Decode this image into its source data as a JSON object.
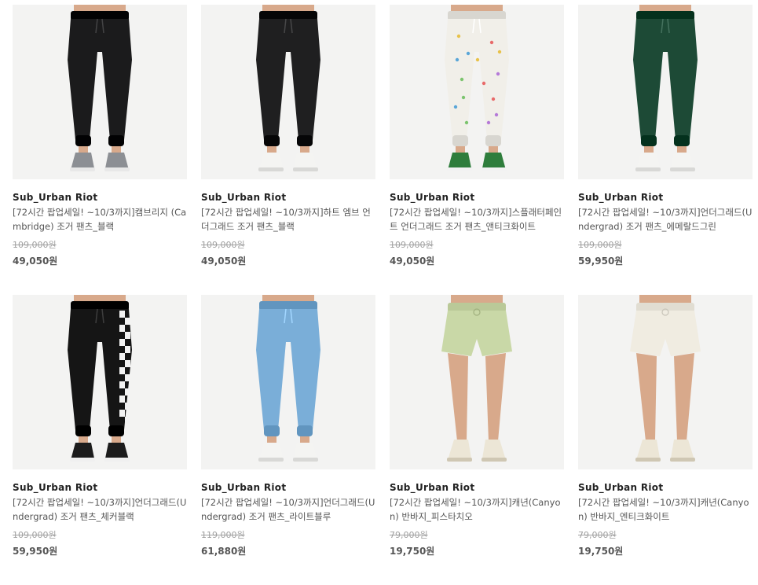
{
  "products": [
    {
      "brand": "Sub_Urban Riot",
      "name": "[72시간 팝업세일! ~10/3까지]캠브리지 (Cambridge) 조거 팬츠_블랙",
      "original_price": "109,000원",
      "sale_price": "49,050원",
      "item_color": "#1b1b1c",
      "type": "jogger",
      "pattern": "plain",
      "shoe": "sneaker-grey",
      "image_icon": "black-jogger-pants-photo"
    },
    {
      "brand": "Sub_Urban Riot",
      "name": "[72시간 팝업세일! ~10/3까지]하트 엠브 언더그래드 조거 팬츠_블랙",
      "original_price": "109,000원",
      "sale_price": "49,050원",
      "item_color": "#1f1f20",
      "type": "jogger",
      "pattern": "plain",
      "shoe": "white",
      "image_icon": "black-jogger-pants-photo"
    },
    {
      "brand": "Sub_Urban Riot",
      "name": "[72시간 팝업세일! ~10/3까지]스플래터페인트 언더그래드 조거 팬츠_앤티크화이트",
      "original_price": "109,000원",
      "sale_price": "49,050원",
      "item_color": "#f1efe9",
      "type": "jogger",
      "pattern": "splatter",
      "shoe": "green",
      "image_icon": "white-splatter-jogger-photo"
    },
    {
      "brand": "Sub_Urban Riot",
      "name": "[72시간 팝업세일! ~10/3까지]언더그래드(Undergrad) 조거 팬츠_에메랄드그린",
      "original_price": "109,000원",
      "sale_price": "59,950원",
      "item_color": "#1d4a36",
      "type": "jogger",
      "pattern": "plain",
      "shoe": "white",
      "image_icon": "green-jogger-pants-photo"
    },
    {
      "brand": "Sub_Urban Riot",
      "name": "[72시간 팝업세일! ~10/3까지]언더그래드(Undergrad) 조거 팬츠_체커블랙",
      "original_price": "109,000원",
      "sale_price": "59,950원",
      "item_color": "#151515",
      "type": "jogger",
      "pattern": "checker",
      "shoe": "black",
      "image_icon": "checker-jogger-pants-photo"
    },
    {
      "brand": "Sub_Urban Riot",
      "name": "[72시간 팝업세일! ~10/3까지]언더그래드(Undergrad) 조거 팬츠_라이트블루",
      "original_price": "119,000원",
      "sale_price": "61,880원",
      "item_color": "#7aaed8",
      "type": "jogger",
      "pattern": "plain",
      "shoe": "white",
      "image_icon": "blue-jogger-pants-photo"
    },
    {
      "brand": "Sub_Urban Riot",
      "name": "[72시간 팝업세일! ~10/3까지]캐년(Canyon) 반바지_피스타치오",
      "original_price": "79,000원",
      "sale_price": "19,750원",
      "item_color": "#c9d8a7",
      "type": "shorts",
      "pattern": "plain",
      "shoe": "cream",
      "image_icon": "pistachio-shorts-photo"
    },
    {
      "brand": "Sub_Urban Riot",
      "name": "[72시간 팝업세일! ~10/3까지]캐년(Canyon) 반바지_엔티크화이트",
      "original_price": "79,000원",
      "sale_price": "19,750원",
      "item_color": "#f0ece1",
      "type": "shorts",
      "pattern": "plain",
      "shoe": "cream",
      "image_icon": "white-shorts-photo"
    }
  ]
}
